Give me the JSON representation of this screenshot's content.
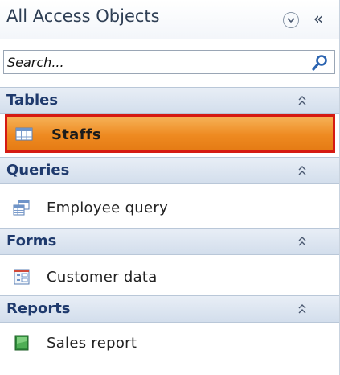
{
  "header": {
    "title": "All Access Objects",
    "menu_icon": "chevron-down-circle-icon",
    "collapse_label": "«"
  },
  "search": {
    "placeholder": "Search...",
    "value": "",
    "icon": "search-icon"
  },
  "groups": [
    {
      "label": "Tables",
      "collapse_icon": "double-chevron-up-icon",
      "items": [
        {
          "label": "Staffs",
          "icon": "table-icon",
          "selected": true
        }
      ]
    },
    {
      "label": "Queries",
      "collapse_icon": "double-chevron-up-icon",
      "items": [
        {
          "label": "Employee query",
          "icon": "query-icon",
          "selected": false
        }
      ]
    },
    {
      "label": "Forms",
      "collapse_icon": "double-chevron-up-icon",
      "items": [
        {
          "label": "Customer data",
          "icon": "form-icon",
          "selected": false
        }
      ]
    },
    {
      "label": "Reports",
      "collapse_icon": "double-chevron-up-icon",
      "items": [
        {
          "label": "Sales report",
          "icon": "report-icon",
          "selected": false
        }
      ]
    }
  ],
  "colors": {
    "selected_fill": "#ee8a21",
    "selected_border": "#d51a12",
    "group_text": "#1f3a6d"
  }
}
